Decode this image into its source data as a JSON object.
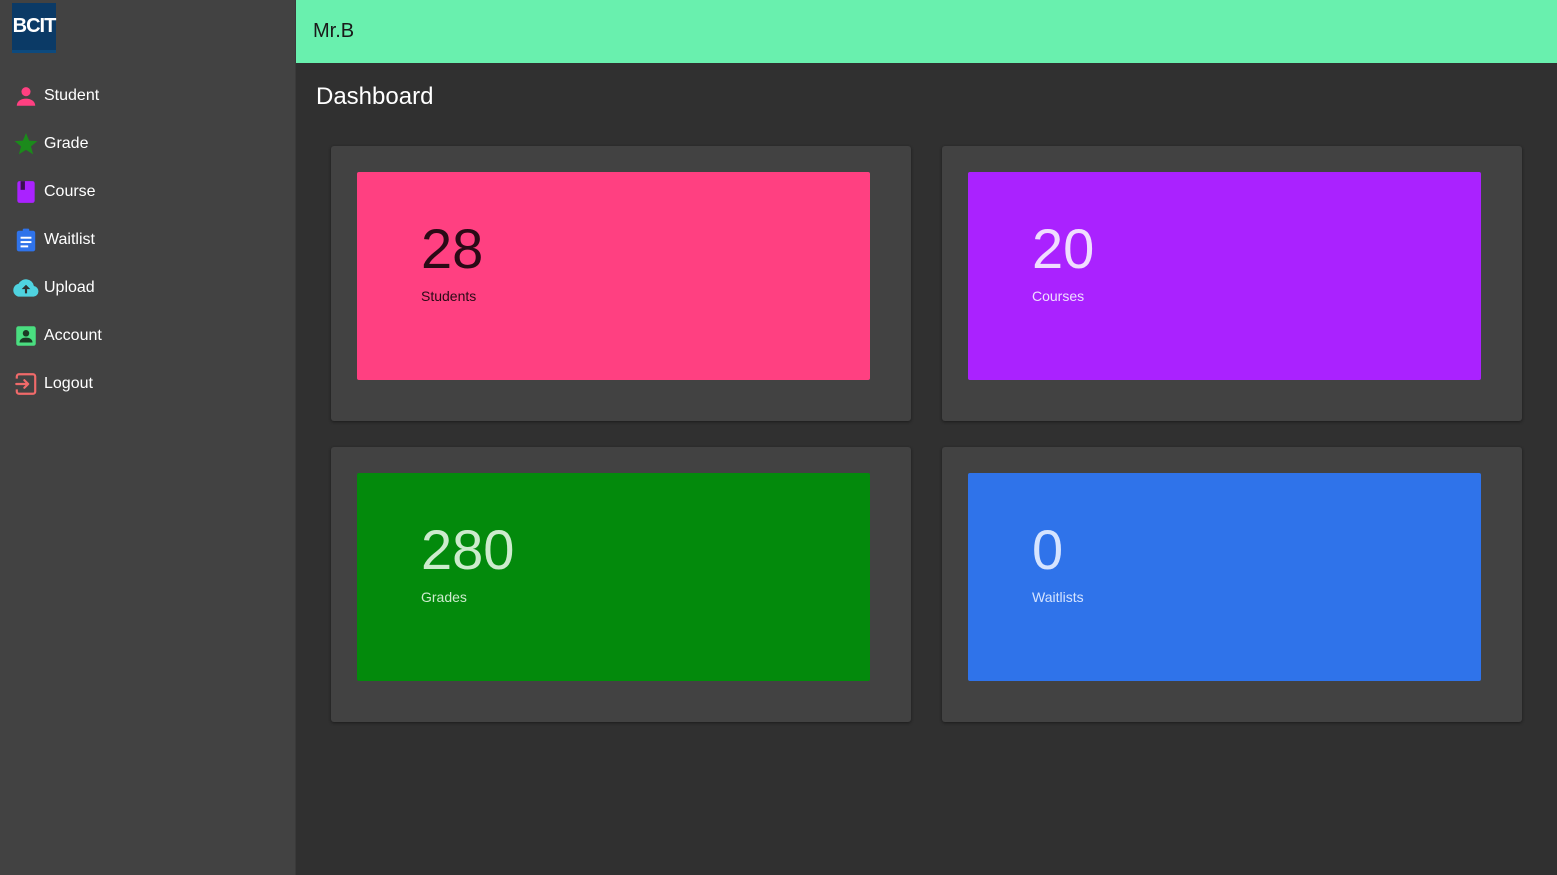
{
  "logo": {
    "text": "BCIT"
  },
  "sidebar": {
    "items": [
      {
        "label": "Student",
        "icon": "person-icon",
        "color": "#ff4081"
      },
      {
        "label": "Grade",
        "icon": "star-icon",
        "color": "#1b8a1b"
      },
      {
        "label": "Course",
        "icon": "book-icon",
        "color": "#aa22ff"
      },
      {
        "label": "Waitlist",
        "icon": "clipboard-list-icon",
        "color": "#2f73ea"
      },
      {
        "label": "Upload",
        "icon": "cloud-upload-icon",
        "color": "#4fd3e0"
      },
      {
        "label": "Account",
        "icon": "account-box-icon",
        "color": "#4ade80"
      },
      {
        "label": "Logout",
        "icon": "logout-icon",
        "color": "#f06a6a"
      }
    ]
  },
  "header": {
    "title": "Mr.B",
    "color": "#69f0ae"
  },
  "main": {
    "title": "Dashboard",
    "stats": {
      "students": {
        "value": "28",
        "label": "Students",
        "color": "#ff4081"
      },
      "courses": {
        "value": "20",
        "label": "Courses",
        "color": "#aa22ff"
      },
      "grades": {
        "value": "280",
        "label": "Grades",
        "color": "#038a0c"
      },
      "waitlist": {
        "value": "0",
        "label": "Waitlists",
        "color": "#2f73ea"
      }
    }
  }
}
